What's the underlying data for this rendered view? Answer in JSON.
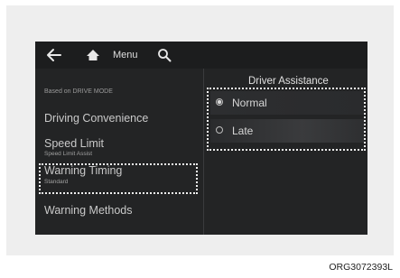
{
  "header": {
    "back_icon": "back-arrow-icon",
    "home_icon": "home-icon",
    "menu_label": "Menu",
    "search_icon": "search-icon"
  },
  "sidebar": {
    "section_label": "Based on DRIVE MODE",
    "items": [
      {
        "label": "Driving Convenience",
        "sublabel": ""
      },
      {
        "label": "Speed Limit",
        "sublabel": "Speed Limit Assist"
      },
      {
        "label": "Warning Timing",
        "sublabel": "Standard",
        "highlighted": true
      },
      {
        "label": "Warning Methods",
        "sublabel": ""
      }
    ]
  },
  "main": {
    "title": "Driver Assistance",
    "options": [
      {
        "label": "Normal",
        "selected": true
      },
      {
        "label": "Late",
        "selected": false
      }
    ]
  },
  "caption": "ORG3072393L",
  "colors": {
    "screen_bg": "#232425",
    "highlight_border": "#f2f2f2"
  }
}
